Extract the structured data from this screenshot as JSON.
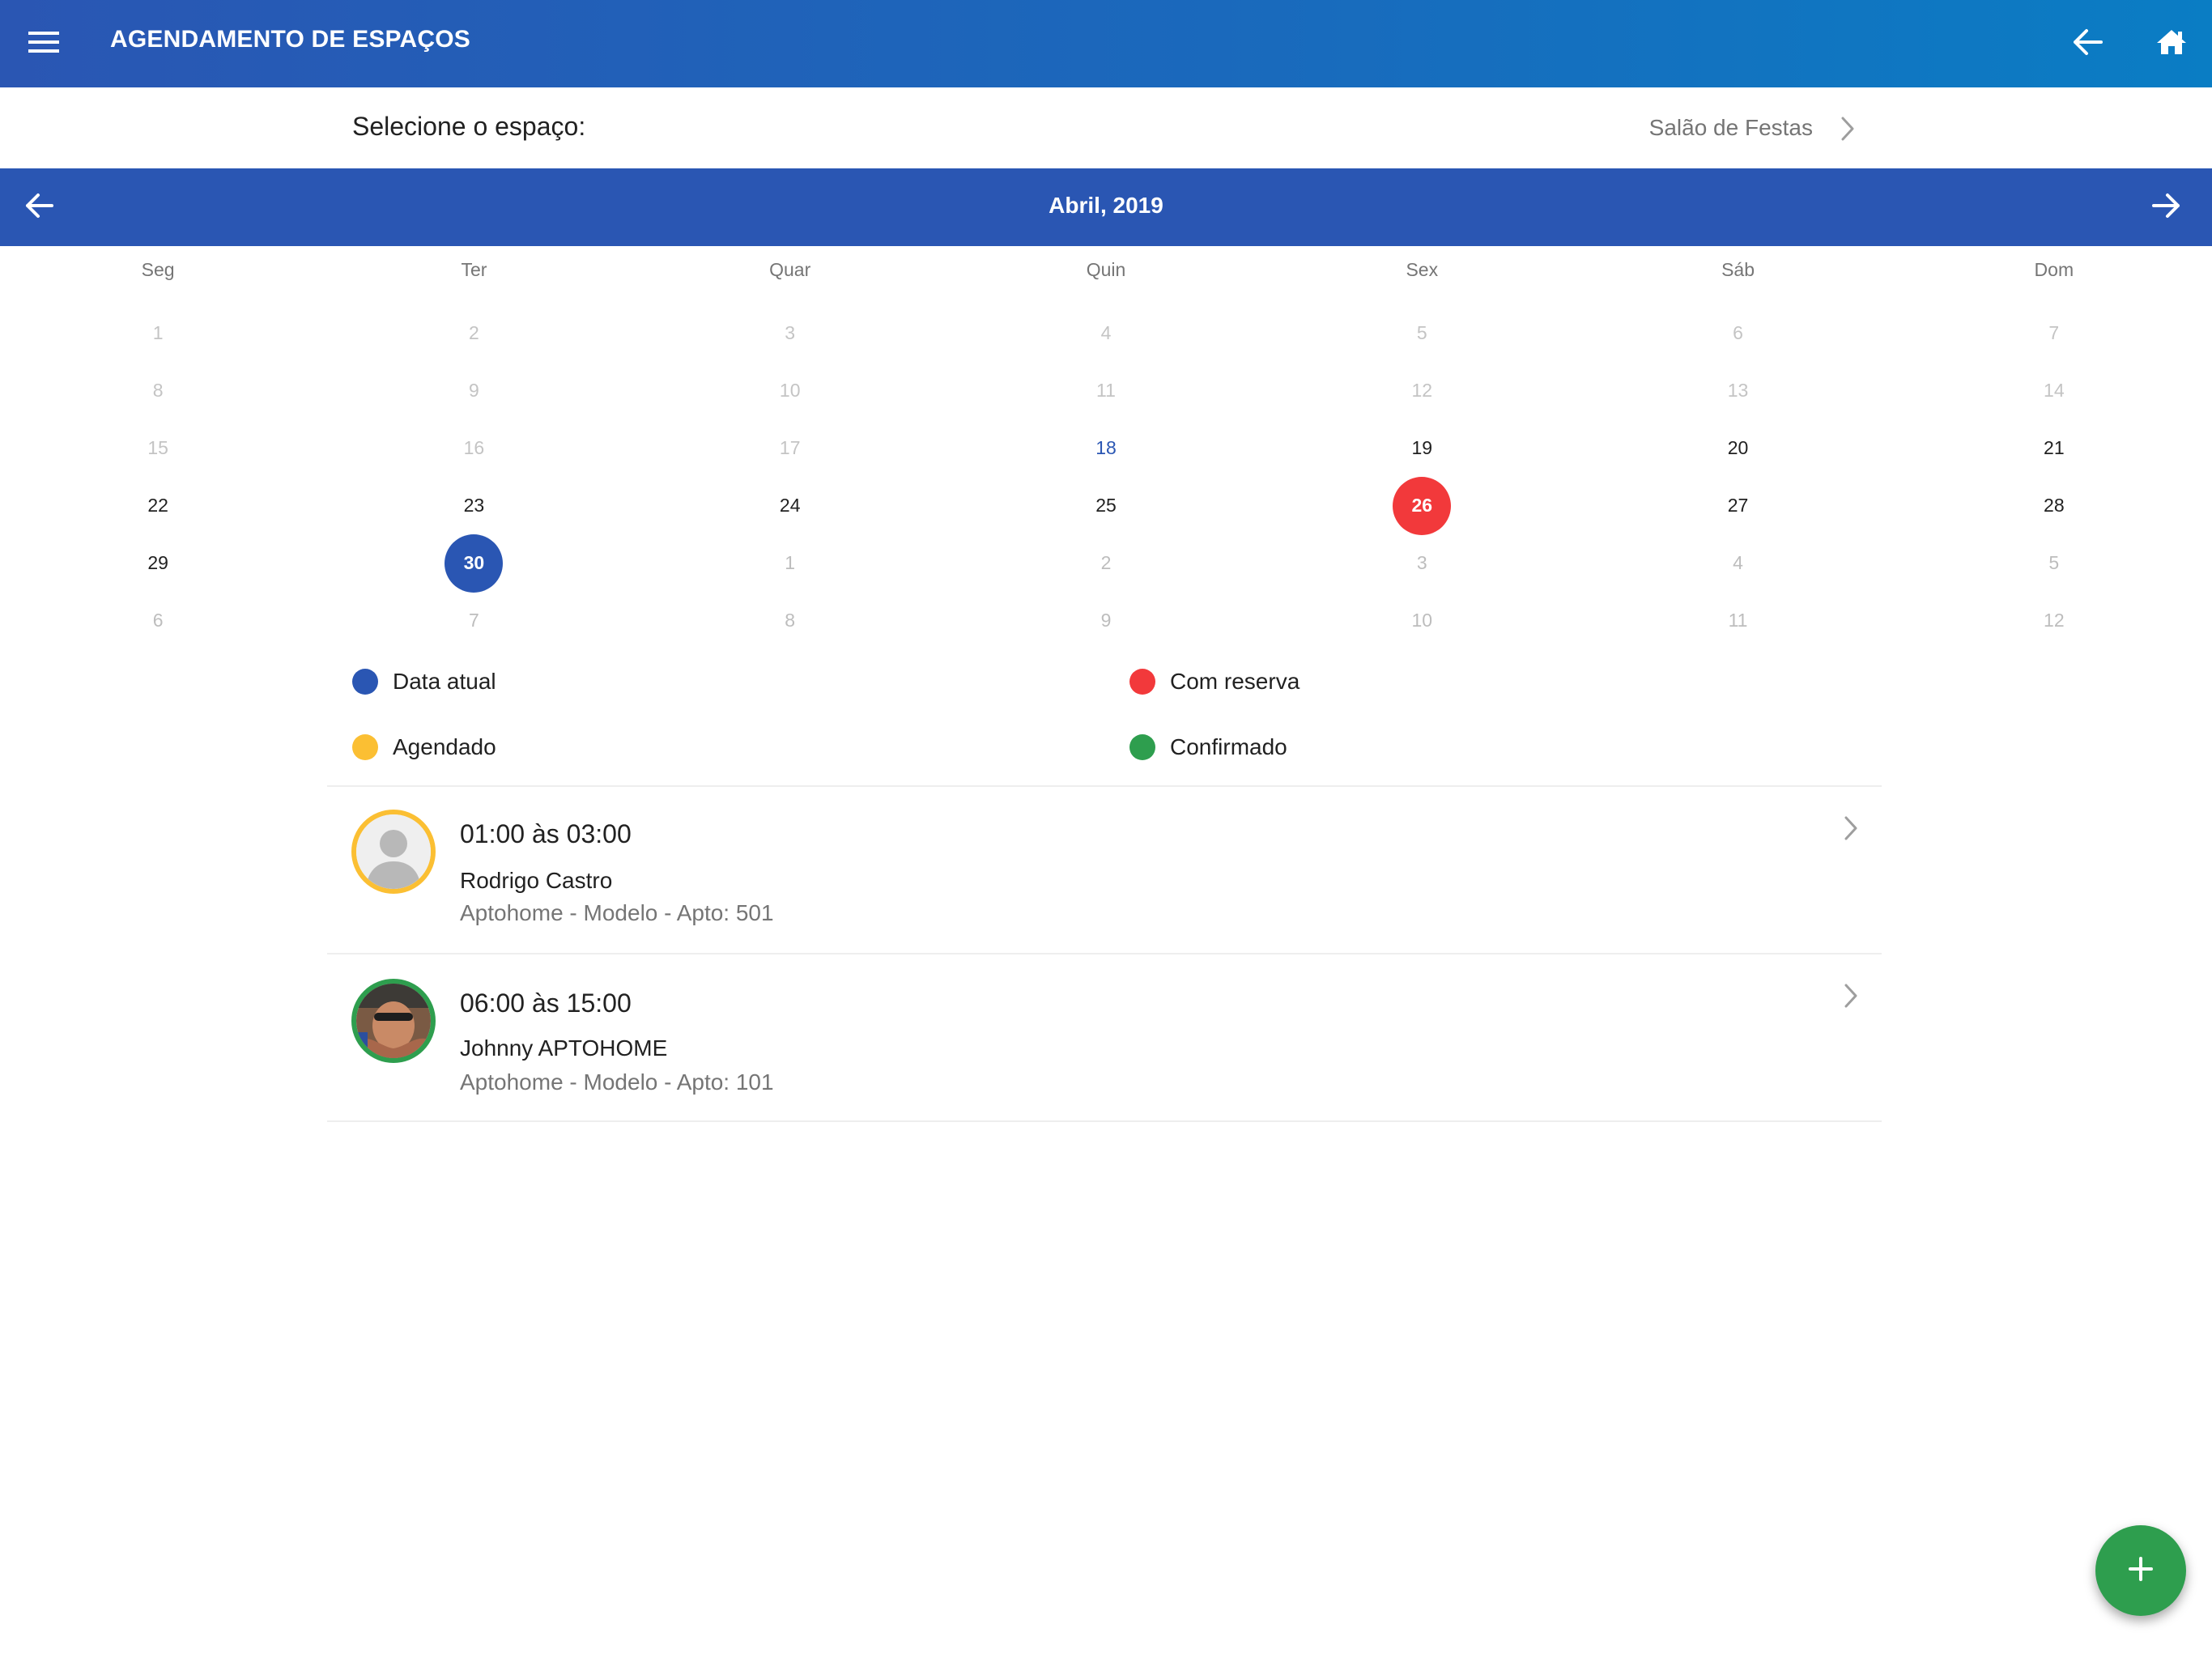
{
  "header": {
    "title": "AGENDAMENTO DE ESPAÇOS",
    "menu_icon": "hamburger-menu-icon",
    "back_icon": "arrow-left-icon",
    "home_icon": "home-icon"
  },
  "space_selector": {
    "label": "Selecione o espaço:",
    "value": "Salão de Festas"
  },
  "calendar": {
    "month_label": "Abril, 2019",
    "weekdays": [
      "Seg",
      "Ter",
      "Quar",
      "Quin",
      "Sex",
      "Sáb",
      "Dom"
    ],
    "weeks": [
      [
        {
          "d": "1",
          "s": "past"
        },
        {
          "d": "2",
          "s": "past"
        },
        {
          "d": "3",
          "s": "past"
        },
        {
          "d": "4",
          "s": "past"
        },
        {
          "d": "5",
          "s": "past"
        },
        {
          "d": "6",
          "s": "past"
        },
        {
          "d": "7",
          "s": "past"
        }
      ],
      [
        {
          "d": "8",
          "s": "past"
        },
        {
          "d": "9",
          "s": "past"
        },
        {
          "d": "10",
          "s": "past"
        },
        {
          "d": "11",
          "s": "past"
        },
        {
          "d": "12",
          "s": "past"
        },
        {
          "d": "13",
          "s": "past"
        },
        {
          "d": "14",
          "s": "past"
        }
      ],
      [
        {
          "d": "15",
          "s": "past"
        },
        {
          "d": "16",
          "s": "past"
        },
        {
          "d": "17",
          "s": "past"
        },
        {
          "d": "18",
          "s": "today"
        },
        {
          "d": "19",
          "s": "normal"
        },
        {
          "d": "20",
          "s": "normal"
        },
        {
          "d": "21",
          "s": "normal"
        }
      ],
      [
        {
          "d": "22",
          "s": "normal"
        },
        {
          "d": "23",
          "s": "normal"
        },
        {
          "d": "24",
          "s": "normal"
        },
        {
          "d": "25",
          "s": "normal"
        },
        {
          "d": "26",
          "s": "reserved"
        },
        {
          "d": "27",
          "s": "normal"
        },
        {
          "d": "28",
          "s": "normal"
        }
      ],
      [
        {
          "d": "29",
          "s": "normal"
        },
        {
          "d": "30",
          "s": "selected"
        },
        {
          "d": "1",
          "s": "other"
        },
        {
          "d": "2",
          "s": "other"
        },
        {
          "d": "3",
          "s": "other"
        },
        {
          "d": "4",
          "s": "other"
        },
        {
          "d": "5",
          "s": "other"
        }
      ],
      [
        {
          "d": "6",
          "s": "other"
        },
        {
          "d": "7",
          "s": "other"
        },
        {
          "d": "8",
          "s": "other"
        },
        {
          "d": "9",
          "s": "other"
        },
        {
          "d": "10",
          "s": "other"
        },
        {
          "d": "11",
          "s": "other"
        },
        {
          "d": "12",
          "s": "other"
        }
      ]
    ]
  },
  "legend": [
    {
      "label": "Data atual",
      "color": "#2a56b3"
    },
    {
      "label": "Com reserva",
      "color": "#f2393b"
    },
    {
      "label": "Agendado",
      "color": "#fbbf33"
    },
    {
      "label": "Confirmado",
      "color": "#2e9e4e"
    }
  ],
  "bookings": [
    {
      "time": "01:00 às 03:00",
      "name": "Rodrigo Castro",
      "detail": "Aptohome - Modelo - Apto: 501",
      "status_color": "#fbbf33",
      "avatar": "default-user-avatar"
    },
    {
      "time": "06:00 às 15:00",
      "name": "Johnny APTOHOME",
      "detail": "Aptohome - Modelo - Apto: 101",
      "status_color": "#2e9e4e",
      "avatar": "user-photo-avatar"
    }
  ],
  "fab": {
    "icon": "plus-icon"
  }
}
